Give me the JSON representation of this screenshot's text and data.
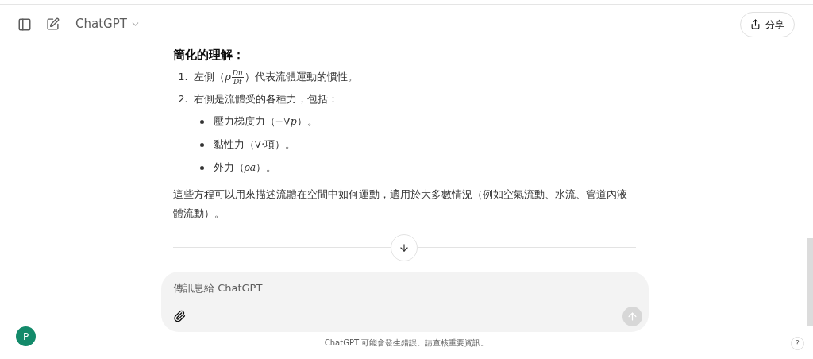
{
  "header": {
    "model": "ChatGPT",
    "share": "分享"
  },
  "message": {
    "heading": "簡化的理解：",
    "numbered": [
      {
        "number": "1.",
        "before": "左側（",
        "math": {
          "kind": "fraction",
          "prefix": "ρ",
          "num": "Du",
          "den": "Dt"
        },
        "after": "）代表流體運動的慣性。"
      },
      {
        "number": "2.",
        "before": "右側是流體受的各種力，包括：",
        "bullets": [
          {
            "before": "壓力梯度力（",
            "math": {
              "kind": "inline",
              "text": "−∇p"
            },
            "after": "）。"
          },
          {
            "before": "黏性力（",
            "math": {
              "kind": "inline",
              "text": "∇·"
            },
            "after": " 項）。"
          },
          {
            "before": "外力（",
            "math": {
              "kind": "inline",
              "text": "ρa"
            },
            "after": "）。"
          }
        ]
      }
    ],
    "paragraph": "這些方程可以用來描述流體在空間中如何運動，適用於大多數情況（例如空氣流動、水流、管道內液體流動）。"
  },
  "composer": {
    "placeholder": "傳訊息給 ChatGPT"
  },
  "disclaimer": "ChatGPT 可能會發生錯誤。請查核重要資訊。",
  "avatar": "P",
  "help": "?"
}
